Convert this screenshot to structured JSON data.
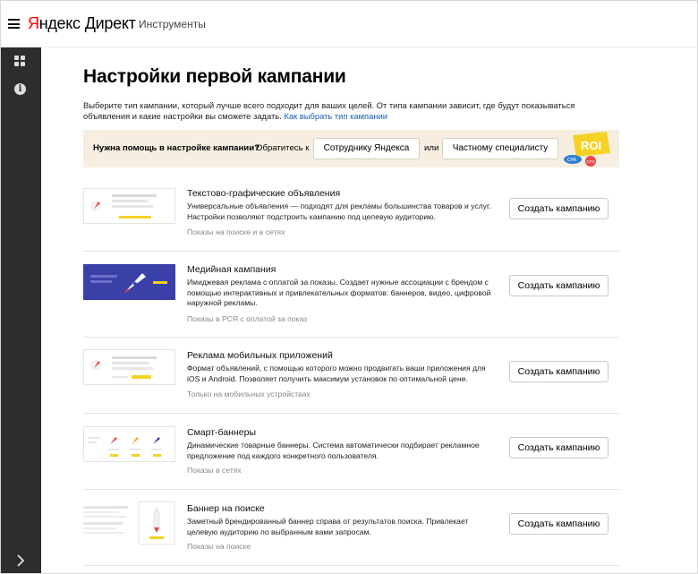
{
  "header": {
    "logo_ya": "Я",
    "logo_rest": "ндекс",
    "logo_direct": "Директ",
    "tools": "Инструменты"
  },
  "sidebar": {
    "icons": [
      "grid-icon",
      "info-icon",
      "chevron-right-icon"
    ]
  },
  "page": {
    "title": "Настройки первой кампании",
    "intro_text": "Выберите тип кампании, который лучше всего подходит для ваших целей. От типа кампании зависит, где будут показываться объявления и какие настройки вы сможете задать.",
    "intro_link": "Как выбрать тип кампании"
  },
  "help": {
    "question": "Нужна помощь в настройке кампании?",
    "contact": "Обратитесь к",
    "button_yandex": "Сотруднику Яндекса",
    "or": "или",
    "button_specialist": "Частному специалисту",
    "art_roi": "ROI",
    "art_cpa": "CPA",
    "art_cpc": "CPC"
  },
  "campaigns": [
    {
      "title": "Текстово-графические объявления",
      "description": "Универсальные объявления — подходят для рекламы большинства товаров и услуг. Настройки позволяют подстроить кампанию под целевую аудиторию.",
      "meta": "Показы на поиске и в сетях",
      "button": "Создать кампанию"
    },
    {
      "title": "Медийная кампания",
      "description": "Имиджевая реклама с оплатой за показы. Создает нужные ассоциации с брендом с помощью интерактивных и привлекательных форматов: баннеров, видео, цифровой наружной рекламы.",
      "meta": "Показы в РСЯ с оплатой за показ",
      "button": "Создать кампанию"
    },
    {
      "title": "Реклама мобильных приложений",
      "description": "Формат объявлений, с помощью которого можно продвигать ваши приложения для iOS и Android. Позволяет получить максимум установок по оптимальной цене.",
      "meta": "Только на мобильных устройствах",
      "button": "Создать кампанию"
    },
    {
      "title": "Смарт-баннеры",
      "description": "Динамические товарные баннеры. Система автоматически подбирает рекламное предложение под каждого конкретного пользователя.",
      "meta": "Показы в сетях",
      "button": "Создать кампанию"
    },
    {
      "title": "Баннер на поиске",
      "description": "Заметный брендированный баннер справа от результатов поиска. Привлекает целевую аудиторию по выбранным вами запросам.",
      "meta": "Показы на поиске",
      "button": "Создать кампанию"
    }
  ],
  "colors": {
    "brand_red": "#ff0000",
    "sidebar": "#2d2d2d",
    "help_bg": "#f6efe1",
    "accent_yellow": "#f5d225",
    "media_blue": "#3a40a8",
    "link": "#1a5fb4"
  }
}
